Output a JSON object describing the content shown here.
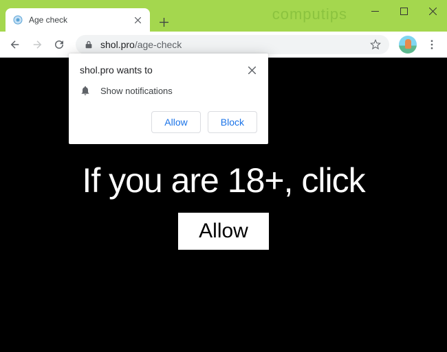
{
  "watermark": "computips",
  "tab": {
    "title": "Age check"
  },
  "url": {
    "domain": "shol.pro",
    "path": "/age-check"
  },
  "permission_dialog": {
    "title": "shol.pro wants to",
    "permission_label": "Show notifications",
    "allow_label": "Allow",
    "block_label": "Block"
  },
  "page": {
    "heading": "If you are 18+, click",
    "button_label": "Allow"
  }
}
